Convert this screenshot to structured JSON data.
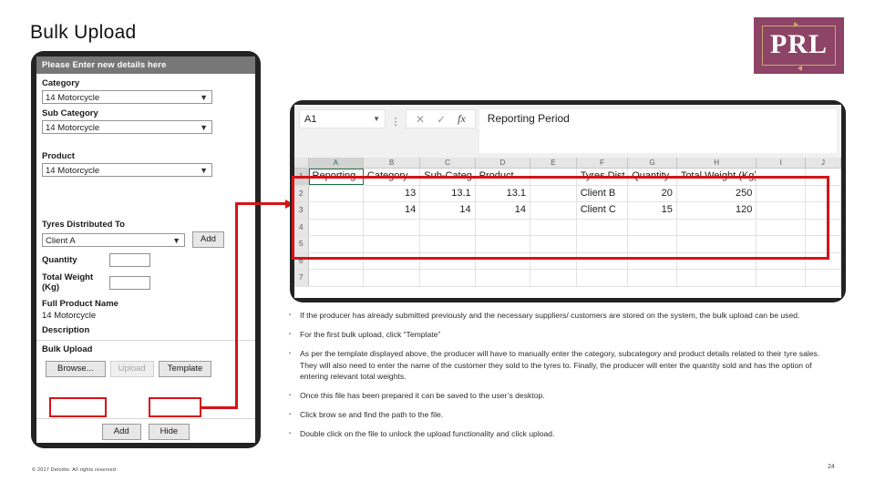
{
  "slide": {
    "title": "Bulk Upload",
    "footer_copyright": "© 2017 Deloitte. All rights reserved",
    "page_number": "24"
  },
  "logo": {
    "wordmark": "PRL",
    "bg_color": "#8d4466",
    "frame_color": "#c8a96a",
    "text_color": "#ffffff"
  },
  "form": {
    "header": "Please Enter new details here",
    "labels": {
      "category": "Category",
      "sub_category": "Sub Category",
      "product": "Product",
      "tyres_distributed_to": "Tyres Distributed To",
      "quantity": "Quantity",
      "total_weight": "Total Weight (Kg)",
      "full_product_name": "Full Product Name",
      "description": "Description",
      "bulk_upload": "Bulk Upload"
    },
    "values": {
      "category": "14 Motorcycle",
      "sub_category": "14 Motorcycle",
      "product": "14 Motorcycle",
      "tyres_distributed_to": "Client A",
      "quantity": "",
      "total_weight": "",
      "full_product_name": "14 Motorcycle",
      "description": ""
    },
    "buttons": {
      "add_client": "Add",
      "browse": "Browse...",
      "upload": "Upload",
      "template": "Template",
      "add": "Add",
      "hide": "Hide"
    },
    "highlight_color": "#d51317"
  },
  "excel": {
    "name_box": "A1",
    "formula_bar": "Reporting Period",
    "icons": {
      "more": "⋮",
      "cancel": "✕",
      "enter": "✓",
      "insert_function": "fx"
    },
    "columns": [
      "A",
      "B",
      "C",
      "D",
      "E",
      "F",
      "G",
      "H",
      "I",
      "J"
    ],
    "row_numbers": [
      "1",
      "2",
      "3",
      "4",
      "5",
      "6",
      "7"
    ],
    "rows": [
      [
        "Reporting",
        "Category",
        "Sub-Categ",
        "Product",
        "",
        "Tyres Dist",
        "Quantity",
        "Total Weight (Kg)",
        "",
        ""
      ],
      [
        "",
        "13",
        "13.1",
        "13.1",
        "",
        "Client B",
        "20",
        "250",
        "",
        ""
      ],
      [
        "",
        "14",
        "14",
        "14",
        "",
        "Client C",
        "15",
        "120",
        "",
        ""
      ],
      [
        "",
        "",
        "",
        "",
        "",
        "",
        "",
        "",
        "",
        ""
      ],
      [
        "",
        "",
        "",
        "",
        "",
        "",
        "",
        "",
        "",
        ""
      ],
      [
        "",
        "",
        "",
        "",
        "",
        "",
        "",
        "",
        "",
        ""
      ],
      [
        "",
        "",
        "",
        "",
        "",
        "",
        "",
        "",
        "",
        ""
      ]
    ],
    "active_cell": "A1",
    "selection_color": "#d51317"
  },
  "bullets": [
    "If the producer has already submitted previously and the necessary suppliers/ customers are stored on the system, the bulk upload can be used.",
    "For the first bulk upload, click “Template”",
    "As per the template displayed above, the producer will have to manually enter the category, subcategory and product details related to their tyre sales. They will also need to enter the name of the customer they sold to the tyres to. Finally, the producer will enter the quantity sold and  has the option of entering relevant total weights.",
    "Once this file has been prepared it can be saved to the user’s desktop.",
    "Click brow se and find the path to the file.",
    "Double click on the file to unlock the upload functionality and click upload."
  ]
}
